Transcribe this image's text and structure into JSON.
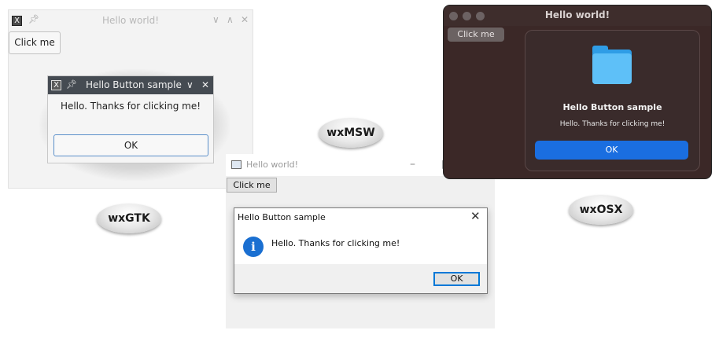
{
  "gtk": {
    "title": "Hello world!",
    "click_label": "Click me",
    "app_icon_glyph": "X",
    "dialog": {
      "title": "Hello Button sample",
      "message": "Hello. Thanks for clicking me!",
      "ok_label": "OK"
    }
  },
  "msw": {
    "title": "Hello world!",
    "click_label": "Click me",
    "dialog": {
      "title": "Hello Button sample",
      "message": "Hello. Thanks for clicking me!",
      "ok_label": "OK",
      "info_glyph": "i"
    }
  },
  "osx": {
    "title": "Hello world!",
    "click_label": "Click me",
    "dialog": {
      "title": "Hello Button sample",
      "message": "Hello. Thanks for clicking me!",
      "ok_label": "OK"
    }
  },
  "labels": {
    "gtk": "wxGTK",
    "msw": "wxMSW",
    "osx": "wxOSX"
  },
  "icons": {
    "pin": "pin-icon",
    "minimize": "minimize-icon",
    "maximize": "maximize-icon",
    "close": "close-icon",
    "info": "info-icon",
    "folder": "folder-icon"
  },
  "colors": {
    "gtk_dialog_titlebar": "#454b52",
    "gtk_ok_border": "#5b8fc9",
    "msw_info": "#1a6fd1",
    "msw_ok_border": "#0078d7",
    "osx_window": "#3b2827",
    "osx_ok": "#1a6ee0",
    "osx_folder": "#5ec0f8"
  }
}
